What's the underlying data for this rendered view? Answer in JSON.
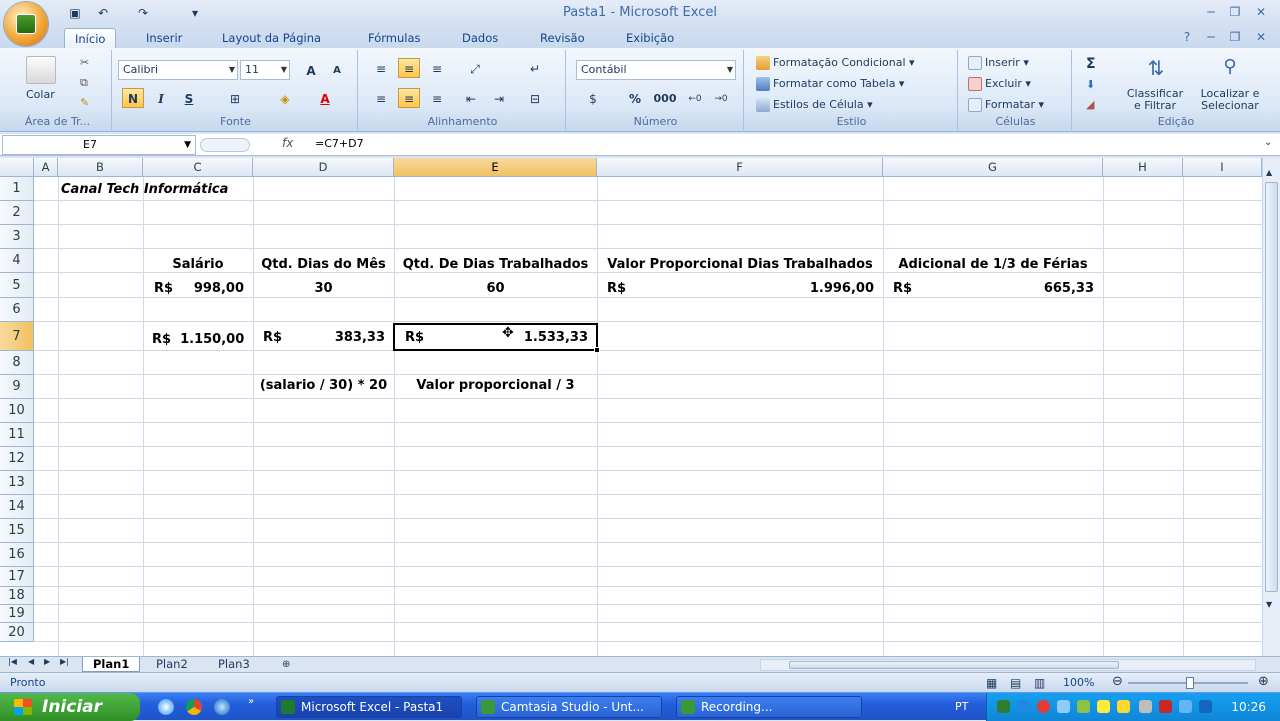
{
  "window": {
    "title": "Pasta1 - Microsoft Excel"
  },
  "ribbon_tabs": [
    "Início",
    "Inserir",
    "Layout da Página",
    "Fórmulas",
    "Dados",
    "Revisão",
    "Exibição"
  ],
  "ribbon": {
    "clipboard": {
      "paste_label": "Colar",
      "group_label": "Área de Tr..."
    },
    "font": {
      "font_name": "Calibri",
      "font_size": "11",
      "bold": "N",
      "italic": "I",
      "underline": "S",
      "group_label": "Fonte"
    },
    "alignment": {
      "group_label": "Alinhamento"
    },
    "number": {
      "format": "Contábil",
      "percent": "%",
      "thousands": "000",
      "group_label": "Número"
    },
    "styles": {
      "cond_format": "Formatação Condicional",
      "format_table": "Formatar como Tabela",
      "cell_styles": "Estilos de Célula",
      "group_label": "Estilo"
    },
    "cells": {
      "insert": "Inserir",
      "delete": "Excluir",
      "format": "Formatar",
      "group_label": "Células"
    },
    "editing": {
      "sum": "Σ",
      "sort_line1": "Classificar",
      "sort_line2": "e Filtrar",
      "find_line1": "Localizar e",
      "find_line2": "Selecionar",
      "group_label": "Edição"
    }
  },
  "formula_bar": {
    "name_box": "E7",
    "fx": "fx",
    "formula": "=C7+D7"
  },
  "columns": [
    "A",
    "B",
    "C",
    "D",
    "E",
    "F",
    "G",
    "H",
    "I"
  ],
  "rows": [
    "1",
    "2",
    "3",
    "4",
    "5",
    "6",
    "7",
    "8",
    "9",
    "10",
    "11",
    "12",
    "13",
    "14",
    "15",
    "16",
    "17",
    "18",
    "19",
    "20"
  ],
  "cells": {
    "b1": "Canal Tech Informática",
    "c4": "Salário",
    "d4": "Qtd. Dias do Mês",
    "e4": "Qtd. De Dias Trabalhados",
    "f4": "Valor Proporcional Dias Trabalhados",
    "g4": "Adicional de 1/3 de Férias",
    "c5_cur": "R$",
    "c5_val": "998,00",
    "d5": "30",
    "e5": "60",
    "f5_cur": "R$",
    "f5_val": "1.996,00",
    "g5_cur": "R$",
    "g5_val": "665,33",
    "c7": "R$  1.150,00",
    "d7_cur": "R$",
    "d7_val": "383,33",
    "e7_cur": "R$",
    "e7_val": "1.533,33",
    "d9": "(salario / 30) * 20",
    "e9": "Valor proporcional / 3"
  },
  "sheet_tabs": [
    "Plan1",
    "Plan2",
    "Plan3"
  ],
  "status": {
    "text": "Pronto",
    "zoom": "100%"
  },
  "taskbar": {
    "start": "Iniciar",
    "tasks": [
      "Microsoft Excel - Pasta1",
      "Camtasia Studio - Unt...",
      "Recording..."
    ],
    "lang": "PT",
    "clock": "10:26"
  }
}
